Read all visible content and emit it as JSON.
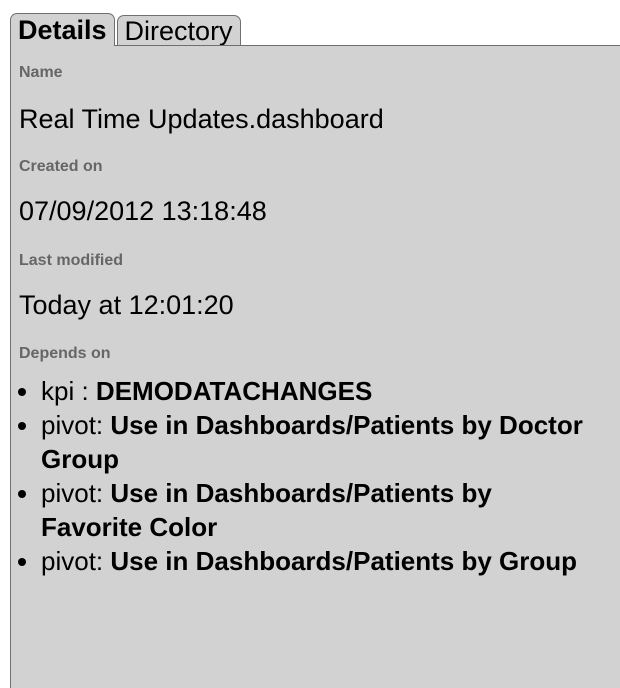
{
  "tabs": [
    {
      "label": "Details",
      "active": true
    },
    {
      "label": "Directory",
      "active": false
    }
  ],
  "details": {
    "name_label": "Name",
    "name_value": "Real Time Updates.dashboard",
    "created_label": "Created on",
    "created_value": "07/09/2012 13:18:48",
    "modified_label": "Last modified",
    "modified_value": "Today at 12:01:20",
    "depends_label": "Depends on",
    "depends": [
      {
        "type": "kpi : ",
        "name": "DEMODATACHANGES"
      },
      {
        "type": "pivot: ",
        "name": "Use in Dashboards/Patients by Doctor Group"
      },
      {
        "type": "pivot: ",
        "name": "Use in Dashboards/Patients by Favorite Color"
      },
      {
        "type": "pivot: ",
        "name": "Use in Dashboards/Patients by Group"
      }
    ]
  },
  "colors": {
    "panel_bg": "#d2d2d2",
    "label_text": "#666666",
    "border": "#6f6f6f"
  }
}
